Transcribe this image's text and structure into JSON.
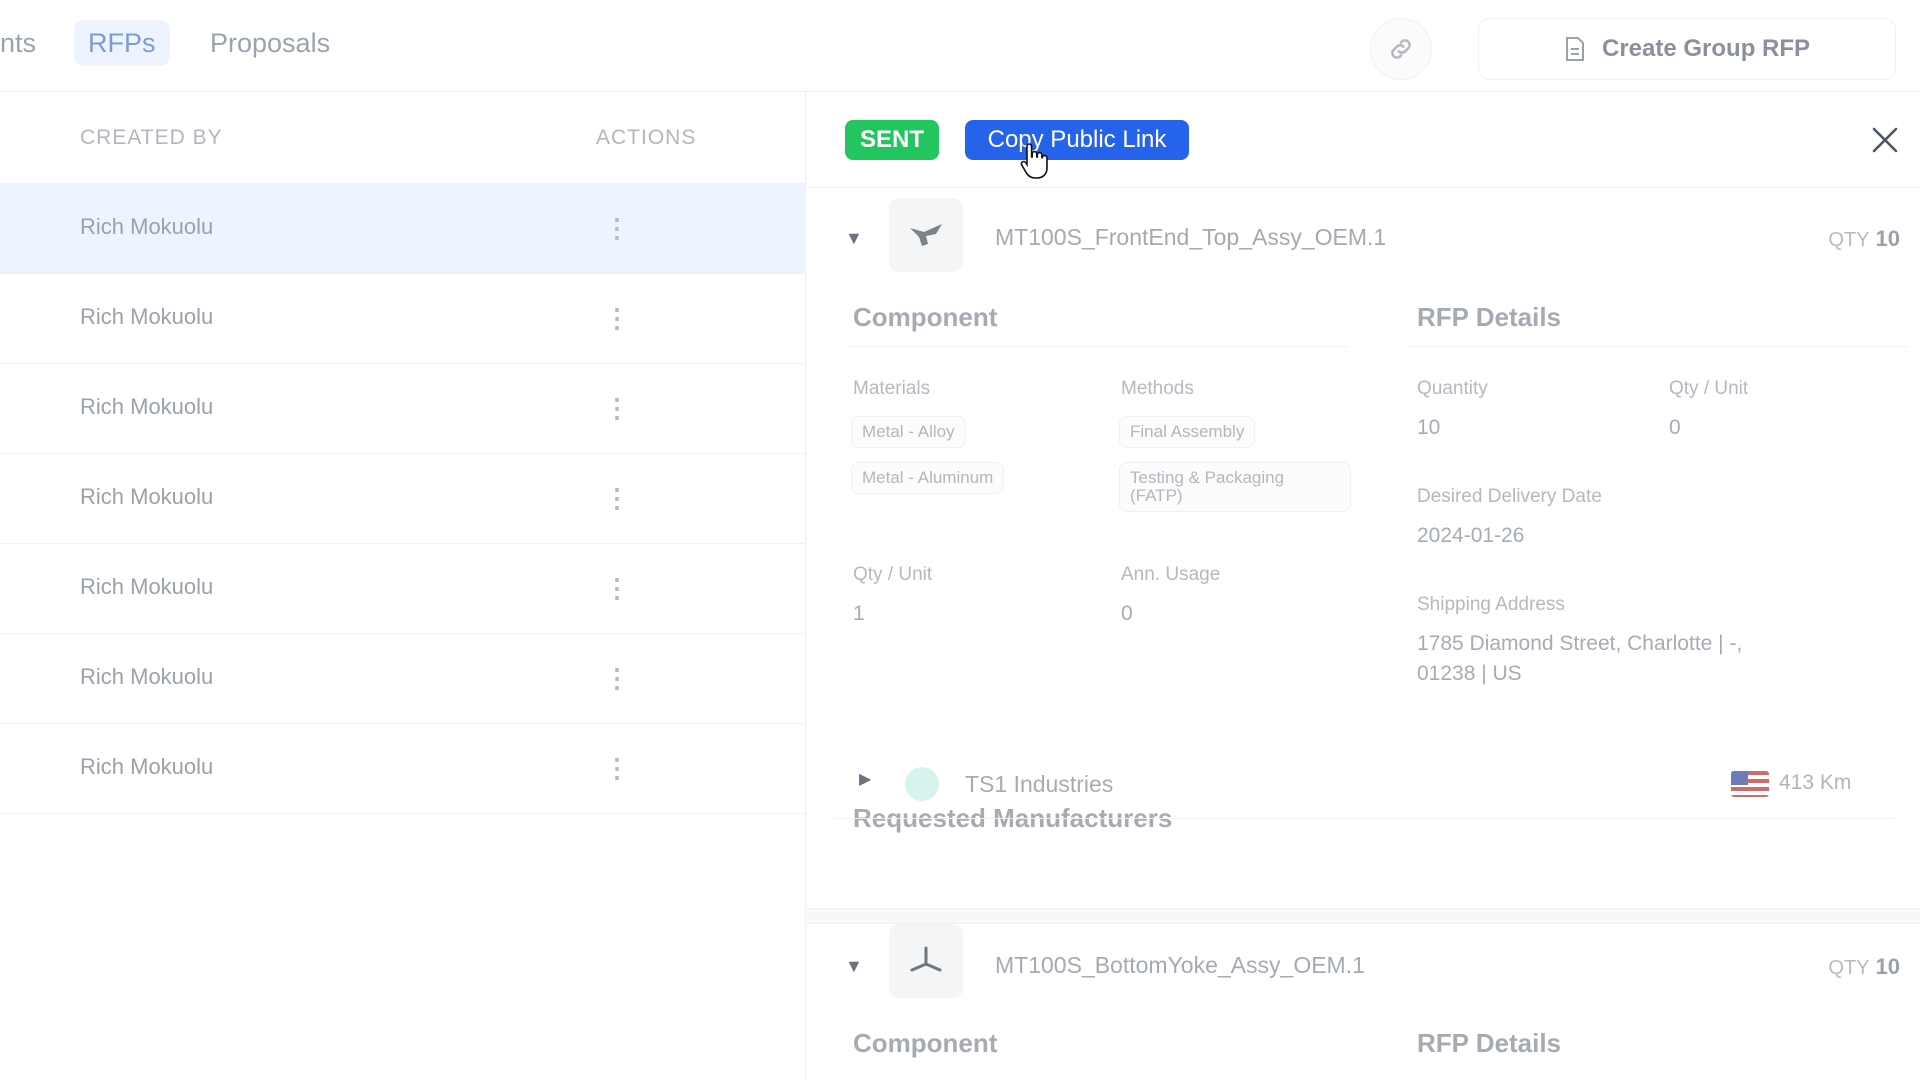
{
  "topbar": {
    "tabs": [
      {
        "label": "nts"
      },
      {
        "label": "RFPs"
      },
      {
        "label": "Proposals"
      }
    ],
    "link_icon": "link-icon",
    "create_group_rfp": "Create Group RFP",
    "create_group_rfp_icon": "document-icon"
  },
  "table": {
    "headers": {
      "created_by": "CREATED BY",
      "actions": "ACTIONS"
    },
    "rows": [
      {
        "created_by": "Rich Mokuolu",
        "selected": true
      },
      {
        "created_by": "Rich Mokuolu"
      },
      {
        "created_by": "Rich Mokuolu"
      },
      {
        "created_by": "Rich Mokuolu"
      },
      {
        "created_by": "Rich Mokuolu"
      },
      {
        "created_by": "Rich Mokuolu"
      },
      {
        "created_by": "Rich Mokuolu"
      }
    ],
    "row_action_icon": "kebab-menu-icon"
  },
  "panel": {
    "status": "SENT",
    "copy_public_link": "Copy Public Link",
    "close_icon": "close-icon",
    "items": [
      {
        "part_name": "MT100S_FrontEnd_Top_Assy_OEM.1",
        "qty_label": "QTY",
        "qty": "10",
        "component_title": "Component",
        "rfp_details_title": "RFP Details",
        "materials_label": "Materials",
        "materials": [
          "Metal - Alloy",
          "Metal - Aluminum"
        ],
        "methods_label": "Methods",
        "methods": [
          "Final Assembly",
          "Testing & Packaging (FATP)"
        ],
        "qty_unit_label": "Qty / Unit",
        "qty_unit": "1",
        "ann_usage_label": "Ann. Usage",
        "ann_usage": "0",
        "quantity_label": "Quantity",
        "quantity": "10",
        "rfp_qty_unit_label": "Qty / Unit",
        "rfp_qty_unit": "0",
        "delivery_label": "Desired Delivery Date",
        "delivery": "2024-01-26",
        "shipping_label": "Shipping Address",
        "shipping_line1": "1785 Diamond Street, Charlotte | -,",
        "shipping_line2": "01238 | US",
        "manufacturers_title": "Requested Manufacturers",
        "manufacturers": [
          {
            "name": "TS1 Industries",
            "distance": "413 Km",
            "flag": "us-flag-icon"
          }
        ]
      },
      {
        "part_name": "MT100S_BottomYoke_Assy_OEM.1",
        "qty_label": "QTY",
        "qty": "10",
        "component_title": "Component",
        "rfp_details_title": "RFP Details"
      }
    ]
  },
  "colors": {
    "sent_badge": "#22c55e",
    "primary_button": "#2563eb",
    "selected_row": "#eef4ff"
  }
}
